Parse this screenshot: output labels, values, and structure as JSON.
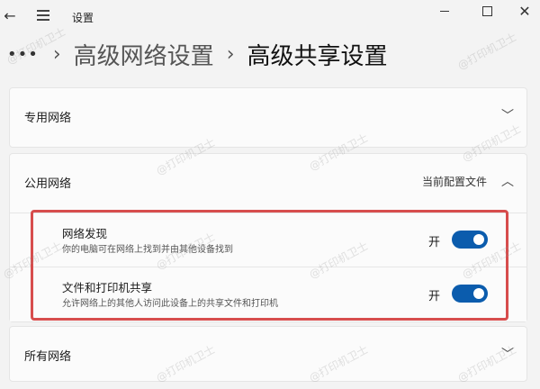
{
  "window": {
    "title": "设置"
  },
  "breadcrumb": {
    "more": "•••",
    "separator": "›",
    "parent": "高级网络设置",
    "current": "高级共享设置"
  },
  "sections": {
    "private": {
      "label": "专用网络"
    },
    "public": {
      "label": "公用网络",
      "profile_tag": "当前配置文件",
      "items": [
        {
          "title": "网络发现",
          "description": "你的电脑可在网络上找到并由其他设备找到",
          "state": "开"
        },
        {
          "title": "文件和打印机共享",
          "description": "允许网络上的其他人访问此设备上的共享文件和打印机",
          "state": "开"
        }
      ]
    },
    "all": {
      "label": "所有网络"
    }
  },
  "watermark": "@打印机卫士",
  "colors": {
    "toggle_on": "#0b5cad",
    "highlight_border": "#d74d4d",
    "background": "#f3f3f3"
  }
}
